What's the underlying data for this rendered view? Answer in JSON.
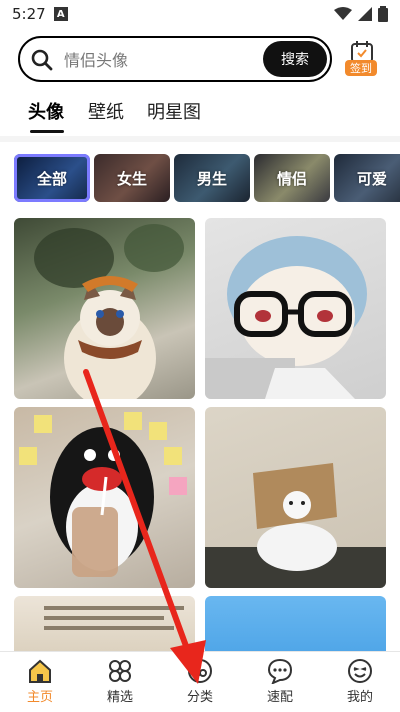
{
  "status": {
    "time": "5:27",
    "app_badge": "A"
  },
  "search": {
    "placeholder": "情侣头像",
    "button": "搜索"
  },
  "signin": {
    "label": "签到"
  },
  "tabs": [
    {
      "label": "头像",
      "active": true
    },
    {
      "label": "壁纸",
      "active": false
    },
    {
      "label": "明星图",
      "active": false
    }
  ],
  "chips": [
    {
      "label": "全部",
      "active": true
    },
    {
      "label": "女生",
      "active": false
    },
    {
      "label": "男生",
      "active": false
    },
    {
      "label": "情侣",
      "active": false
    },
    {
      "label": "可爱",
      "active": false
    }
  ],
  "nav": [
    {
      "label": "主页",
      "icon": "home-icon",
      "active": true
    },
    {
      "label": "精选",
      "icon": "clover-icon",
      "active": false
    },
    {
      "label": "分类",
      "icon": "category-icon",
      "active": false
    },
    {
      "label": "速配",
      "icon": "chat-bubble-icon",
      "active": false
    },
    {
      "label": "我的",
      "icon": "smile-face-icon",
      "active": false
    }
  ],
  "colors": {
    "accent": "#f28a2c",
    "chip_active_border": "#7c7bff",
    "arrow": "#e8261c"
  }
}
